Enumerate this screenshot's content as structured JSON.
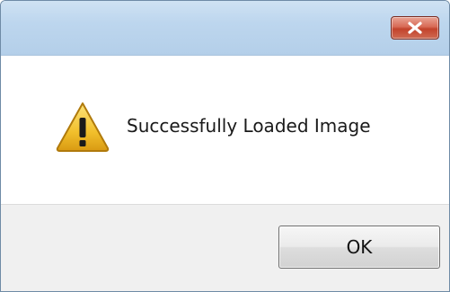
{
  "dialog": {
    "message": "Successfully Loaded Image",
    "icon": "warning-icon",
    "ok_label": "OK",
    "close_icon": "close-icon"
  },
  "colors": {
    "titlebar": "#bdd6ee",
    "close_button": "#c9503a",
    "footer": "#f0f0f0",
    "warning_yellow": "#f3c52f"
  }
}
